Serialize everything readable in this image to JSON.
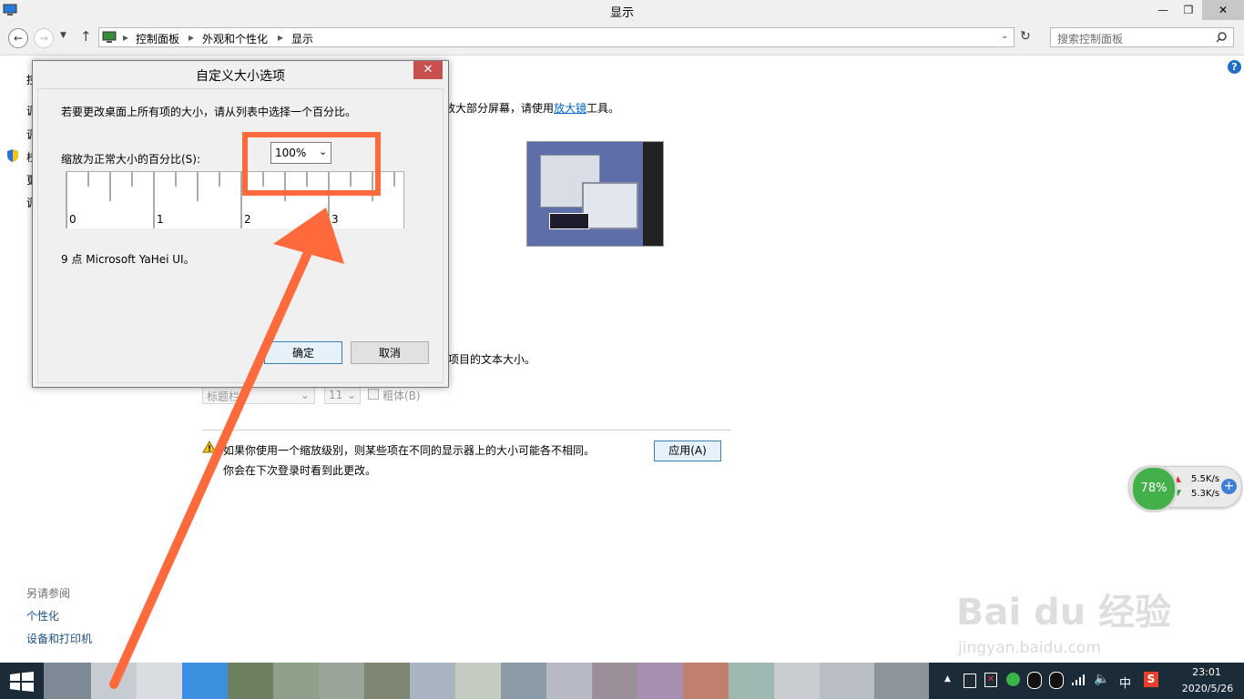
{
  "window": {
    "title": "显示"
  },
  "address": {
    "path": [
      "控制面板",
      "外观和个性化",
      "显示"
    ]
  },
  "search": {
    "placeholder": "搜索控制面板"
  },
  "left_nav": {
    "partial_items": [
      "控",
      "调",
      "调",
      "校",
      "更",
      "调"
    ],
    "see_also_title": "另请参阅",
    "see_also": [
      "个性化",
      "设备和打印机"
    ]
  },
  "main": {
    "magnifier_text_pre": "放大部分屏幕，请使用",
    "magnifier_link": "放大镜",
    "magnifier_text_post": "工具。",
    "text_size_partial": "项目的文本大小。",
    "element_select": "标题栏",
    "size_select": "11",
    "bold_label": "粗体(B)",
    "warning_line1": "如果你使用一个缩放级别，则某些项在不同的显示器上的大小可能各不相同。",
    "warning_line2": "你会在下次登录时看到此更改。",
    "apply_label": "应用(A)"
  },
  "dialog": {
    "title": "自定义大小选项",
    "instruction": "若要更改桌面上所有项的大小，请从列表中选择一个百分比。",
    "scale_label": "缩放为正常大小的百分比(S):",
    "scale_value": "100%",
    "ruler_numbers": [
      "0",
      "1",
      "2",
      "3"
    ],
    "font_sample": "9 点 Microsoft YaHei UI。",
    "ok_label": "确定",
    "cancel_label": "取消"
  },
  "net_widget": {
    "percent": "78%",
    "upload": "5.5K/s",
    "download": "5.3K/s"
  },
  "taskbar": {
    "time": "23:01",
    "date": "2020/5/26",
    "ime": "中"
  },
  "watermark": {
    "brand": "Bai du 经验",
    "url": "jingyan.baidu.com"
  },
  "colors": {
    "annotation": "#ff6a3d",
    "link": "#0066cc",
    "close": "#c75050"
  }
}
